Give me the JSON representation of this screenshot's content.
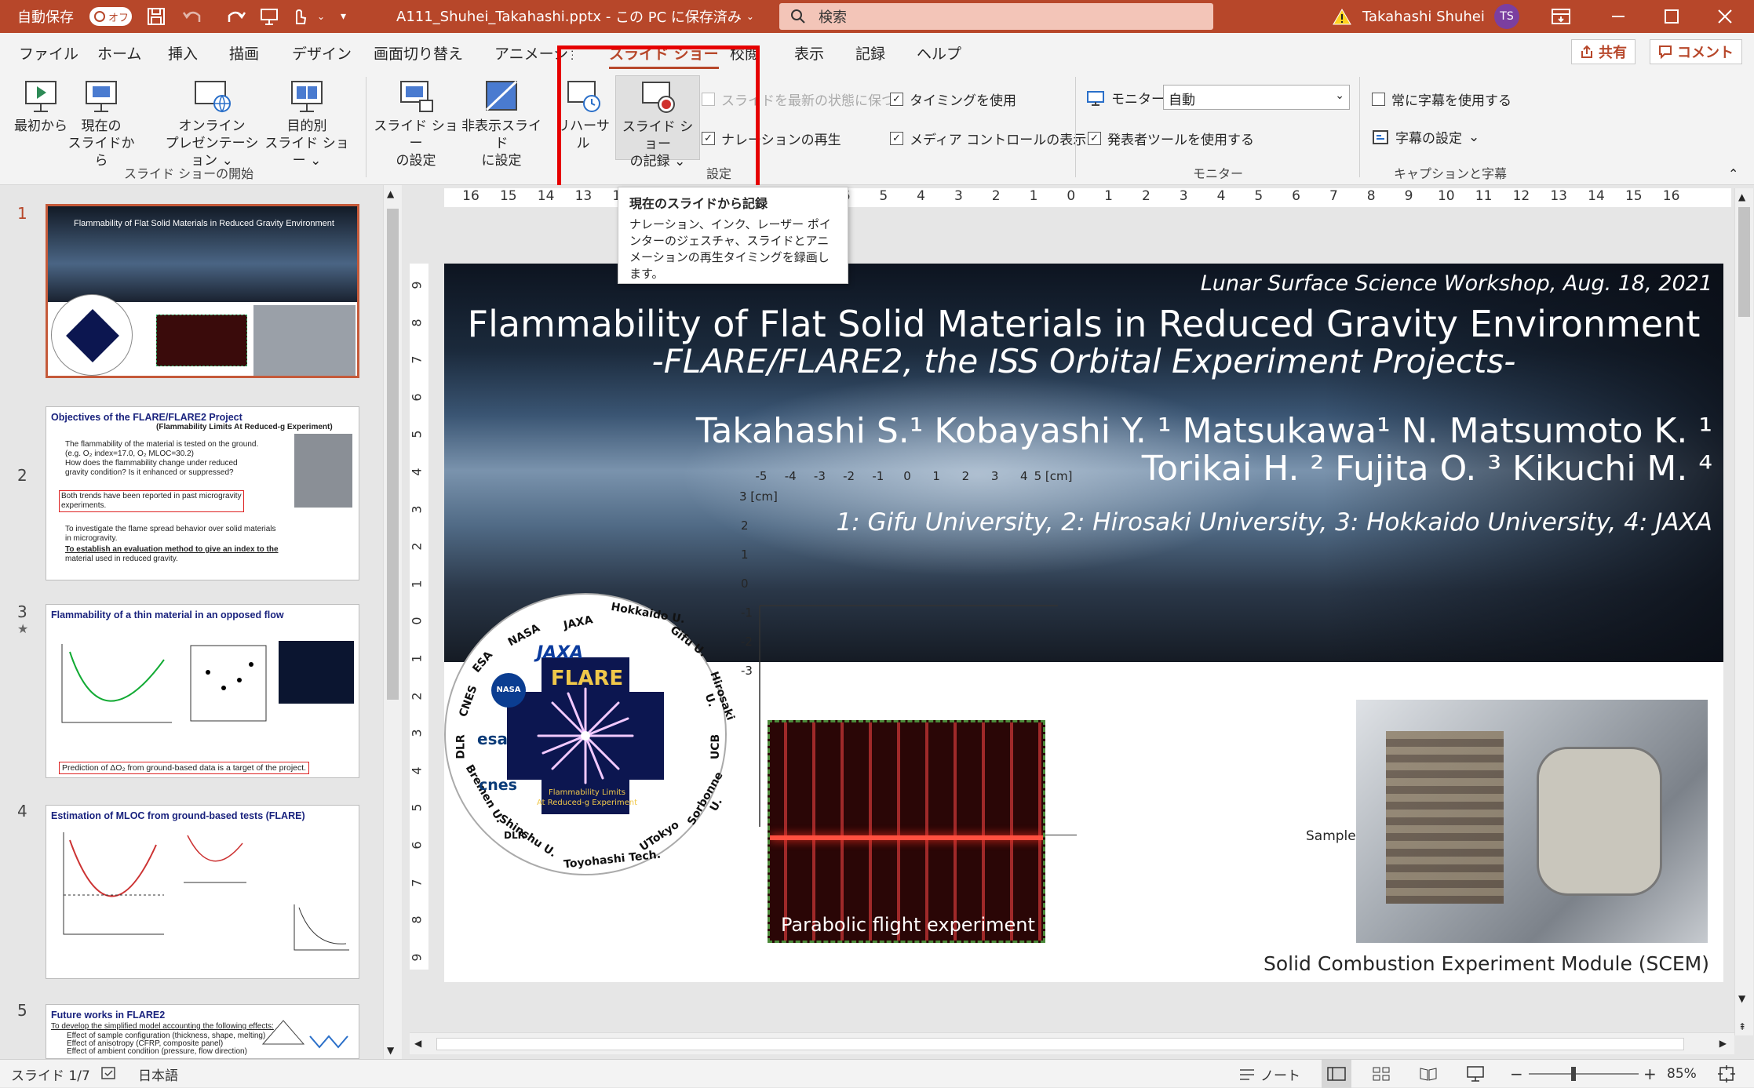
{
  "titlebar": {
    "autosave_label": "自動保存",
    "autosave_state": "オフ",
    "filename": "A111_Shuhei_Takahashi.pptx",
    "save_state": "この PC に保存済み",
    "search_placeholder": "検索",
    "user_name": "Takahashi Shuhei",
    "user_initials": "TS"
  },
  "menu": {
    "tabs": [
      "ファイル",
      "ホーム",
      "挿入",
      "描画",
      "デザイン",
      "画面切り替え",
      "アニメーション",
      "スライド ショー",
      "校閲",
      "表示",
      "記録",
      "ヘルプ"
    ],
    "active_tab": "スライド ショー",
    "share_label": "共有",
    "comment_label": "コメント"
  },
  "ribbon": {
    "start_group": {
      "label": "スライド ショーの開始",
      "from_start": "最初から",
      "from_current_1": "現在の",
      "from_current_2": "スライドから",
      "online_1": "オンライン",
      "online_2": "プレゼンテーション",
      "custom_1": "目的別",
      "custom_2": "スライド ショー"
    },
    "setup_group": {
      "label": "設定",
      "setup_1": "スライド ショー",
      "setup_2": "の設定",
      "hide_1": "非表示スライド",
      "hide_2": "に設定",
      "rehearse": "リハーサル",
      "record_1": "スライド ショー",
      "record_2": "の記録",
      "keep_updated": "スライドを最新の状態に保つ",
      "play_narration": "ナレーションの再生",
      "use_timings": "タイミングを使用",
      "show_media_controls": "メディア コントロールの表示"
    },
    "monitor_group": {
      "label": "モニター",
      "monitor_label": "モニター:",
      "monitor_value": "自動",
      "presenter_view": "発表者ツールを使用する"
    },
    "caption_group": {
      "label": "キャプションと字幕",
      "always_subtitles": "常に字幕を使用する",
      "subtitle_settings": "字幕の設定"
    }
  },
  "tooltip": {
    "title": "現在のスライドから記録",
    "body": "ナレーション、インク、レーザー ポインターのジェスチャ、スライドとアニメーションの再生タイミングを録画します。"
  },
  "thumbnails": [
    {
      "num": "1",
      "title": "Flammability of Flat Solid Materials in Reduced Gravity Environment"
    },
    {
      "num": "2",
      "title": "Objectives of the FLARE/FLARE2 Project",
      "subtitle": "(Flammability Limits At Reduced-g Experiment)",
      "lines": [
        "The flammability of the material is tested on the ground.",
        "(e.g. O₂ index=17.0, O₂ MLOC=30.2)",
        "How does the flammability change under reduced",
        "gravity condition? Is it enhanced or suppressed?",
        "Both trends have been reported in past microgravity",
        "experiments.",
        "To investigate the flame spread behavior over solid materials",
        "in microgravity.",
        "To establish an evaluation method to give an index to the",
        "material used in reduced gravity."
      ]
    },
    {
      "num": "3",
      "title": "Flammability of a thin material in an opposed flow",
      "footer": "Prediction of ΔO₂ from ground-based data is a target of the project."
    },
    {
      "num": "4",
      "title": "Estimation of MLOC from ground-based tests (FLARE)"
    },
    {
      "num": "5",
      "title": "Future works in FLARE2",
      "lines": [
        "To develop the simplified model accounting the following effects:",
        "Effect of sample configuration (thickness, shape, melting)",
        "Effect of anisotropy (CFRP, composite panel)",
        "Effect of ambient condition (pressure, flow direction)"
      ]
    }
  ],
  "hruler_ticks": [
    "16",
    "15",
    "14",
    "13",
    "12",
    "11",
    "10",
    "9",
    "8",
    "7",
    "6",
    "5",
    "4",
    "3",
    "2",
    "1",
    "0",
    "1",
    "2",
    "3",
    "4",
    "5",
    "6",
    "7",
    "8",
    "9",
    "10",
    "11",
    "12",
    "13",
    "14",
    "15",
    "16"
  ],
  "vruler_ticks": [
    "9",
    "8",
    "7",
    "6",
    "5",
    "4",
    "3",
    "2",
    "1",
    "0",
    "1",
    "2",
    "3",
    "4",
    "5",
    "6",
    "7",
    "8",
    "9"
  ],
  "slide": {
    "workshop": "Lunar Surface Science Workshop, Aug. 18, 2021",
    "title": "Flammability of Flat Solid Materials in Reduced Gravity Environment",
    "subtitle": "-FLARE/FLARE2, the ISS Orbital Experiment Projects-",
    "authors_1": "Takahashi S.¹ Kobayashi Y. ¹ Matsukawa¹ N. Matsumoto K. ¹",
    "authors_2": "Torikai H. ² Fujita O. ³ Kikuchi M. ⁴",
    "affiliations": "1: Gifu University, 2: Hirosaki University, 3: Hokkaido University, 4: JAXA",
    "logo_center": "FLARE",
    "logo_tagline_1": "Flammability Limits",
    "logo_tagline_2": "At Reduced-g Experiment",
    "ring_labels": [
      "JAXA",
      "Hokkaido U.",
      "Gifu U.",
      "Hirosaki U.",
      "UCB",
      "Sorbonne U.",
      "UTokyo",
      "Toyohashi Tech.",
      "Shinshu U.",
      "Bremen U.",
      "DLR",
      "CNES",
      "ESA",
      "NASA"
    ],
    "inner_logos": [
      "JAXA",
      "NASA",
      "esa",
      "cnes",
      "DLR"
    ],
    "x_ticks": [
      "-5",
      "-4",
      "-3",
      "-2",
      "-1",
      "0",
      "1",
      "2",
      "3",
      "4",
      "5 [cm]"
    ],
    "y_ticks": [
      "3 [cm]",
      "2",
      "1",
      "0",
      "-1",
      "-2",
      "-3"
    ],
    "sample_label": "Sample",
    "flight_caption": "Parabolic flight  experiment",
    "scem_caption": "Solid Combustion Experiment Module (SCEM)"
  },
  "status": {
    "slide_indicator": "スライド 1/7",
    "language": "日本語",
    "notes": "ノート",
    "zoom": "85%"
  },
  "colors": {
    "accent": "#b7472a",
    "highlight_box": "#e60000",
    "title_blue": "#1a237e"
  }
}
